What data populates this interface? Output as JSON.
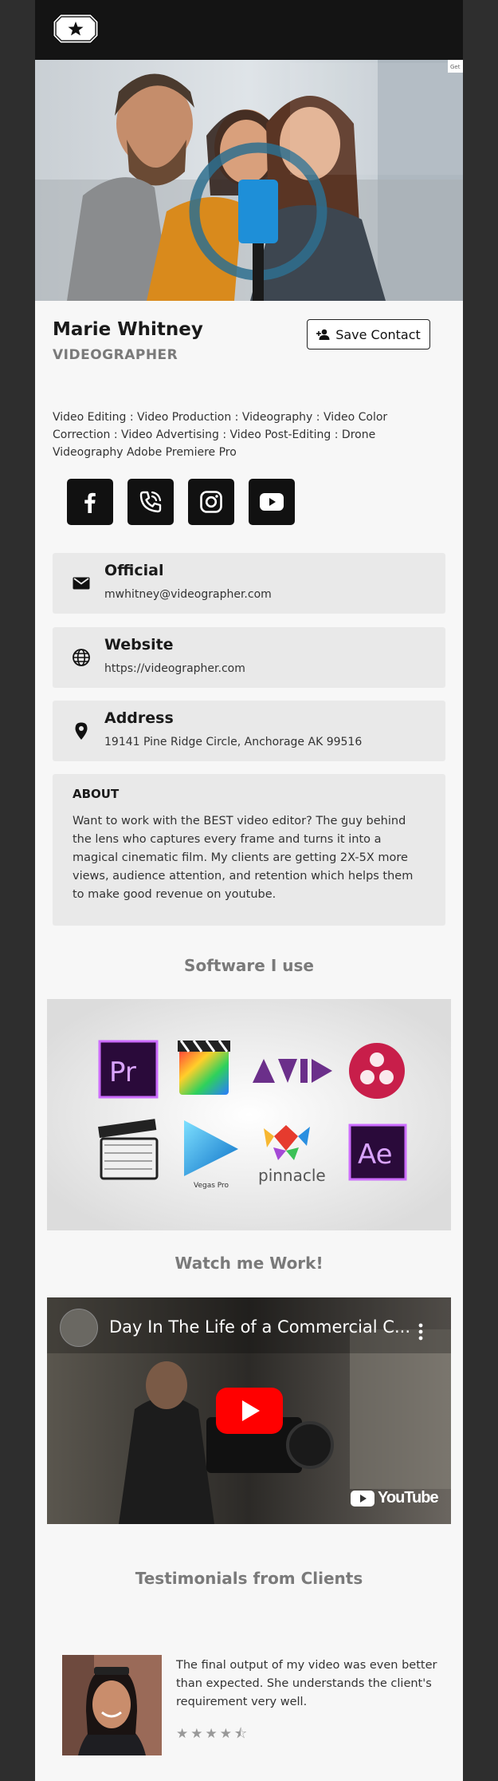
{
  "header": {
    "logo_icon": "star-badge-icon"
  },
  "hero": {
    "image": "group-selfie-ring-light-photo",
    "corner_label": "Get"
  },
  "profile": {
    "name": "Marie Whitney",
    "title": "VIDEOGRAPHER",
    "save_label": "Save Contact",
    "skills": "Video Editing : Video Production : Videography : Video Color Correction : Video Advertising : Video Post-Editing : Drone Videography Adobe Premiere Pro"
  },
  "social": [
    {
      "icon": "facebook-icon"
    },
    {
      "icon": "phone-icon"
    },
    {
      "icon": "instagram-icon"
    },
    {
      "icon": "youtube-icon"
    }
  ],
  "contacts": [
    {
      "icon": "mail-icon",
      "label": "Official",
      "value": "mwhitney@videographer.com"
    },
    {
      "icon": "globe-icon",
      "label": "Website",
      "value": "https://videographer.com"
    },
    {
      "icon": "location-pin-icon",
      "label": "Address",
      "value": "19141 Pine Ridge Circle, Anchorage AK 99516"
    }
  ],
  "about": {
    "heading": "ABOUT",
    "text": "Want to work with the BEST video editor? The guy behind the lens who captures every frame and turns it into a magical cinematic film. My clients are getting 2X-5X more views, audience attention, and retention which helps them to make good revenue on youtube."
  },
  "software": {
    "heading": "Software I use",
    "logos": [
      "Pr",
      "Final Cut Pro",
      "AVID",
      "DaVinci Resolve",
      "Clapperboard",
      "Vegas Pro",
      "pinnacle",
      "Ae"
    ],
    "vegas_label": "Vegas Pro",
    "pinnacle_label": "pinnacle"
  },
  "video": {
    "heading": "Watch me Work!",
    "title": "Day In The Life of a Commercial C...",
    "brand": "YouTube"
  },
  "testimonials": {
    "heading": "Testimonials from Clients",
    "items": [
      {
        "text": "The final output of my video was even better than expected. She understands the client's requirement very well.",
        "rating": 4.5,
        "stars": "★★★★⯪"
      }
    ]
  },
  "colors": {
    "topbar": "#141414",
    "page_bg": "#2e2e2e",
    "card_bg": "#f7f7f7",
    "info_bg": "#e9e9e9",
    "youtube_red": "#ff0000"
  }
}
